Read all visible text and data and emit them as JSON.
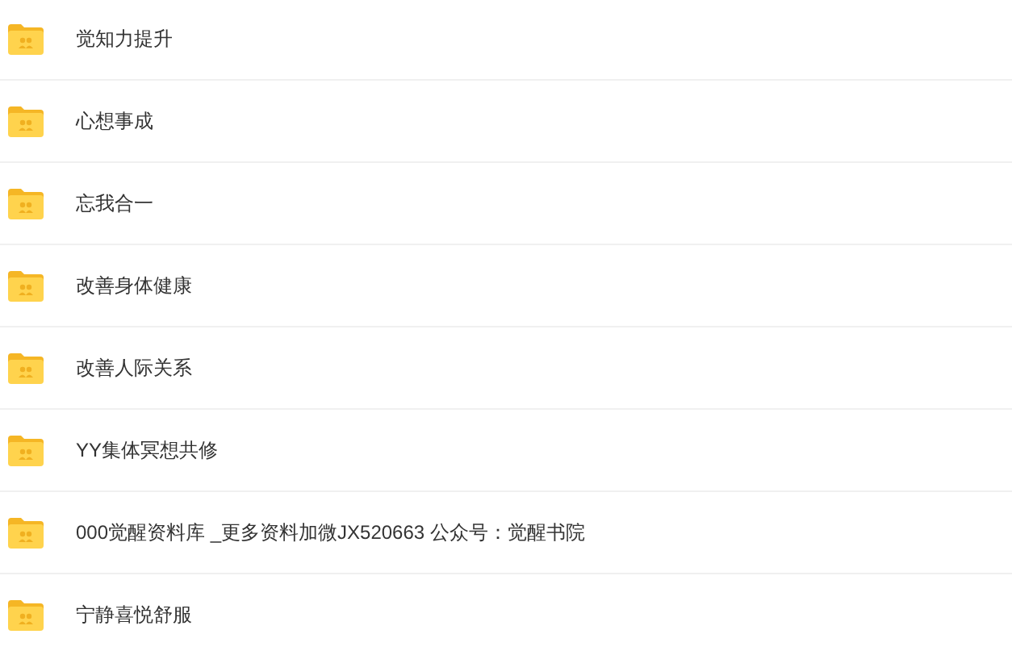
{
  "folders": [
    {
      "name": "觉知力提升"
    },
    {
      "name": "心想事成"
    },
    {
      "name": "忘我合一"
    },
    {
      "name": "改善身体健康"
    },
    {
      "name": "改善人际关系"
    },
    {
      "name": "YY集体冥想共修"
    },
    {
      "name": "000觉醒资料库 _更多资料加微JX520663 公众号：觉醒书院"
    },
    {
      "name": "宁静喜悦舒服"
    }
  ]
}
